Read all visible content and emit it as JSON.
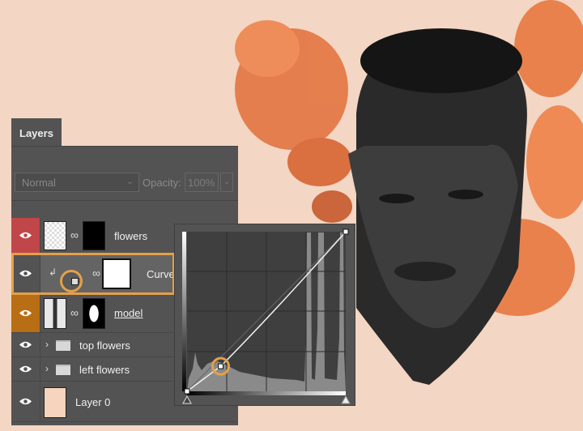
{
  "panel": {
    "title": "Layers"
  },
  "blend_mode": {
    "value": "Normal"
  },
  "opacity": {
    "label": "Opacity:",
    "value": "100%"
  },
  "layers": [
    {
      "name": "flowers",
      "eye_color": "#c0464a"
    },
    {
      "name": "Curves",
      "eye_color": "#535353"
    },
    {
      "name": "model",
      "eye_color": "#b86e14"
    },
    {
      "name": "top flowers",
      "type": "group"
    },
    {
      "name": "left flowers",
      "type": "group"
    },
    {
      "name": "Layer 0",
      "fill": "#f6d4bd"
    }
  ],
  "curves": {
    "points": [
      [
        0,
        0
      ],
      [
        54,
        40
      ],
      [
        255,
        255
      ]
    ],
    "highlight_color": "#e3a04a"
  },
  "colors": {
    "background": "#f3d6c3",
    "panel": "#535353",
    "accent": "#e3a04a"
  }
}
